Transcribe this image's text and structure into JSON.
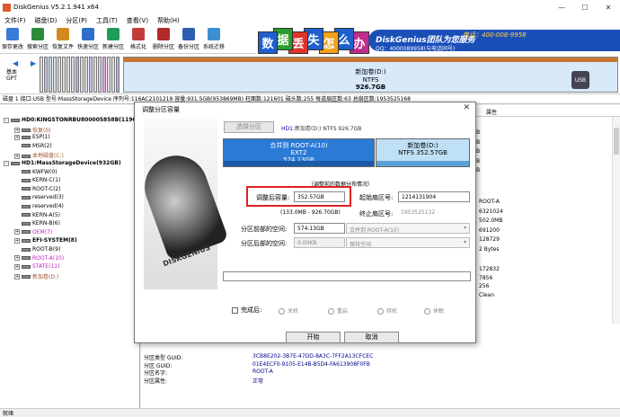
{
  "app": {
    "title": "DiskGenius V5.2.1.941 x64"
  },
  "menu": [
    "文件(F)",
    "磁盘(D)",
    "分区(P)",
    "工具(T)",
    "查看(V)",
    "帮助(H)"
  ],
  "toolbar": [
    {
      "label": "保存更改",
      "color": "#3a7bd5"
    },
    {
      "label": "搜索分区",
      "color": "#2d8a3a"
    },
    {
      "label": "恢复文件",
      "color": "#d28a1e"
    },
    {
      "label": "快速分区",
      "color": "#2f6fc8"
    },
    {
      "label": "新建分区",
      "color": "#1e9c5a"
    },
    {
      "label": "格式化",
      "color": "#c23b3b"
    },
    {
      "label": "删除分区",
      "color": "#b02a2a"
    },
    {
      "label": "备份分区",
      "color": "#2f5fb0"
    },
    {
      "label": "系统迁移",
      "color": "#3b8fd0"
    }
  ],
  "banner": {
    "chars": [
      "数",
      "据",
      "丢",
      "失",
      "怎",
      "么",
      "办"
    ],
    "char_colors": [
      "#1f5fcf",
      "#2b9b2e",
      "#e0342a",
      "#1f5fcf",
      "#f1a11a",
      "#1f5fcf",
      "#c02c8a"
    ],
    "promo": "DiskGenius团队为您服务",
    "phone": "电话：400-008-9958",
    "qq": "QQ：4000089958(与电话同号)"
  },
  "diskmap": {
    "label_top": "基本",
    "label_bottom": "GPT",
    "big_name": "新加卷(D:)",
    "big_fs": "NTFS",
    "big_size": "926.7GB"
  },
  "infobar": "磁盘 1 接口:USB  型号:MassStorageDevice  序列号:116AC2101219  容量:931.5GB(953869MB)  柱面数:121601  磁头数:255  每道扇区数:63  总扇区数:1953525168",
  "tree": [
    {
      "text": "HD0:KINGSTONRBU800005858B(119GB)",
      "color": "#000",
      "bold": true,
      "indent": 0,
      "ex": "-",
      "disk": true
    },
    {
      "text": "恢复(0)",
      "color": "#a0522d",
      "indent": 1,
      "ex": "+"
    },
    {
      "text": "ESP(1)",
      "color": "#000",
      "indent": 1,
      "ex": "+"
    },
    {
      "text": "MSR(2)",
      "color": "#000",
      "indent": 1,
      "ex": ""
    },
    {
      "text": "本地磁盘(C:)",
      "color": "#a0522d",
      "indent": 1,
      "ex": "+"
    },
    {
      "text": "HD1:MassStorageDevice(932GB)",
      "color": "#000",
      "bold": true,
      "indent": 0,
      "ex": "-",
      "disk": true
    },
    {
      "text": "KWFW(0)",
      "color": "#000",
      "indent": 1,
      "ex": ""
    },
    {
      "text": "KERN-C(1)",
      "color": "#000",
      "indent": 1,
      "ex": ""
    },
    {
      "text": "ROOT-C(2)",
      "color": "#000",
      "indent": 1,
      "ex": ""
    },
    {
      "text": "reserved(3)",
      "color": "#000",
      "indent": 1,
      "ex": ""
    },
    {
      "text": "reserved(4)",
      "color": "#000",
      "indent": 1,
      "ex": ""
    },
    {
      "text": "KERN-A(5)",
      "color": "#000",
      "indent": 1,
      "ex": ""
    },
    {
      "text": "KERN-B(6)",
      "color": "#000",
      "indent": 1,
      "ex": ""
    },
    {
      "text": "OEM(7)",
      "color": "#c020c0",
      "indent": 1,
      "ex": "+"
    },
    {
      "text": "EFI-SYSTEM(8)",
      "color": "#000",
      "bold": true,
      "indent": 1,
      "ex": "+"
    },
    {
      "text": "ROOT-B(9)",
      "color": "#000",
      "indent": 1,
      "ex": ""
    },
    {
      "text": "ROOT-A(10)",
      "color": "#c020c0",
      "indent": 1,
      "ex": "+"
    },
    {
      "text": "STATE(11)",
      "color": "#c020c0",
      "indent": 1,
      "ex": "+"
    },
    {
      "text": "新加卷(D:)",
      "color": "#a0522d",
      "indent": 1,
      "ex": "+"
    }
  ],
  "right_header": {
    "col_attr": "属性"
  },
  "right_col_values": [
    "B",
    "B",
    "B",
    "B",
    "B"
  ],
  "right_mid": [
    "ROOT-A",
    "6321024",
    "502.0MB",
    "691200",
    "128729",
    "2 Bytes"
  ],
  "right_mid2": [
    "172832",
    "7856",
    "256",
    "Clean"
  ],
  "lower": {
    "labels": [
      "分区类型 GUID:",
      "分区 GUID:",
      "分区名字:",
      "分区属性:"
    ],
    "values": [
      "3CB8E202-3B7E-47DD-8A3C-7FF2A13CFCEC",
      "01E4ECF0-9105-E14B-B5D4-FA613908F0FB",
      "ROOT-A",
      "正常"
    ]
  },
  "statusbar": "就绪",
  "dialog": {
    "title": "调整分区容量",
    "close": "✕",
    "select_btn": "选择分区",
    "header_disk": "HD1:",
    "header_part": "新加卷(D:) NTFS 926.7GB",
    "part_a": {
      "l1": "合并到 ROOT-A(10)",
      "l2": "EXT2",
      "l3": "574.13GB"
    },
    "part_b": {
      "l1": "新加卷(D:)",
      "l2": "NTFS 352.57GB"
    },
    "section": "（调整前的数据分布情况）",
    "size_label": "调整后容量:",
    "size_value": "352.57GB",
    "start_label": "起始扇区号:",
    "start_value": "1214131904",
    "range_hint": "(133.0MB - 926.70GB)",
    "end_label": "终止扇区号:",
    "end_value": "1953525132",
    "before_label": "分区前部的空间:",
    "before_value": "574.13GB",
    "before_select": "合并到 ROOT-A(10)",
    "after_label": "分区后部的空间:",
    "after_value": "0.00KB",
    "after_select": "保持空闲",
    "done_label": "完成后:",
    "radios": [
      "关机",
      "重启",
      "待机",
      "休眠"
    ],
    "start_btn": "开始",
    "cancel_btn": "取消"
  }
}
